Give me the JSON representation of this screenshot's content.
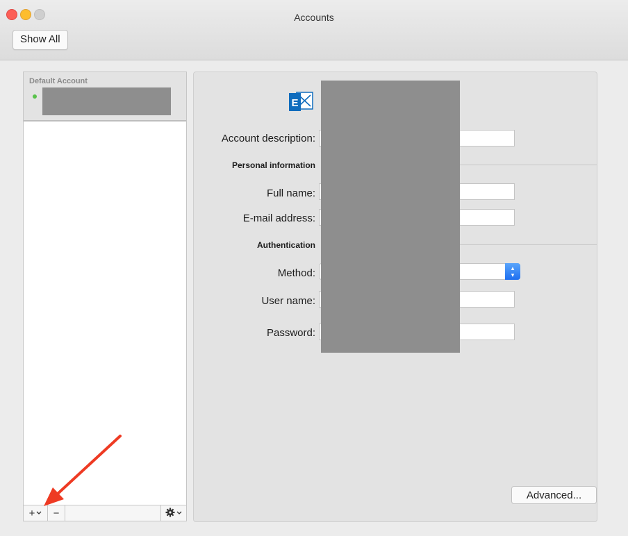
{
  "window": {
    "title": "Accounts"
  },
  "toolbar": {
    "show_all_label": "Show All"
  },
  "sidebar": {
    "group_label": "Default Account",
    "account": {
      "status": "online",
      "status_color": "#58c24a",
      "name": ""
    },
    "buttons": {
      "add": "+",
      "remove": "−",
      "gear": "✱",
      "chevron": "⌄"
    }
  },
  "panel": {
    "account_icon": "exchange-icon",
    "account_description_label": "Account description:",
    "personal_info_heading": "Personal information",
    "full_name_label": "Full name:",
    "email_label": "E-mail address:",
    "authentication_heading": "Authentication",
    "method_label": "Method:",
    "username_label": "User name:",
    "password_label": "Password:",
    "advanced_label": "Advanced..."
  },
  "colors": {
    "annotation_arrow": "#ee3a23",
    "select_accent": "#2f80f6",
    "exchange_blue": "#0f6cbd"
  }
}
